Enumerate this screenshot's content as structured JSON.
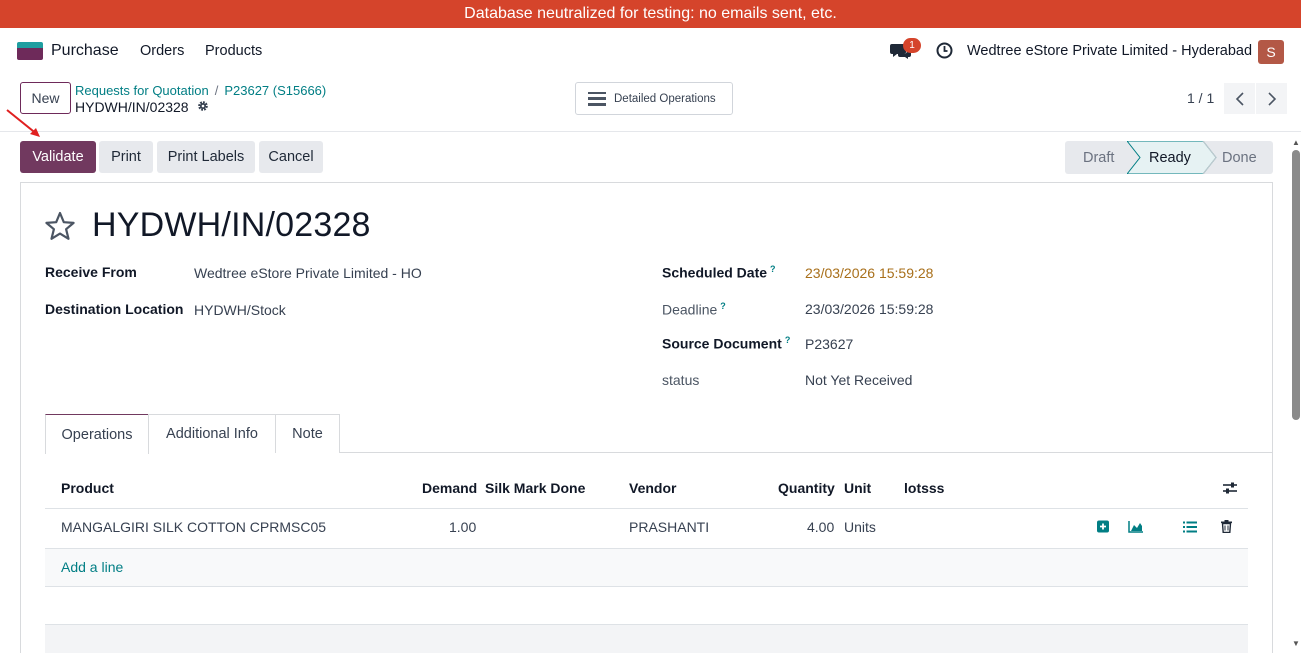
{
  "banner": {
    "text": "Database neutralized for testing: no emails sent, etc."
  },
  "nav": {
    "app_name": "Purchase",
    "menu": [
      "Orders",
      "Products"
    ],
    "chat_badge": "1",
    "company": "Wedtree eStore Private Limited - Hyderabad",
    "avatar_initial": "S"
  },
  "control": {
    "new_label": "New",
    "breadcrumb": [
      "Requests for Quotation",
      "P23627 (S15666)"
    ],
    "breadcrumb_sep": "/",
    "current": "HYDWH/IN/02328",
    "detailed_ops_label": "Detailed Operations",
    "pager": "1 / 1"
  },
  "actions": {
    "validate": "Validate",
    "print": "Print",
    "print_labels": "Print Labels",
    "cancel": "Cancel"
  },
  "status_steps": [
    "Draft",
    "Ready",
    "Done"
  ],
  "status_current": "Ready",
  "record": {
    "title": "HYDWH/IN/02328",
    "receive_from_label": "Receive From",
    "receive_from": "Wedtree eStore Private Limited - HO",
    "destination_label": "Destination Location",
    "destination": "HYDWH/Stock",
    "scheduled_label": "Scheduled Date",
    "scheduled": "23/03/2026 15:59:28",
    "deadline_label": "Deadline",
    "deadline": "23/03/2026 15:59:28",
    "source_label": "Source Document",
    "source": "P23627",
    "status_label": "status",
    "status": "Not Yet Received",
    "help_mark": "?"
  },
  "tabs": [
    "Operations",
    "Additional Info",
    "Note"
  ],
  "table": {
    "headers": {
      "product": "Product",
      "demand": "Demand",
      "silk_mark": "Silk Mark Done",
      "vendor": "Vendor",
      "quantity": "Quantity",
      "unit": "Unit",
      "lots": "lotsss"
    },
    "rows": [
      {
        "product": "MANGALGIRI SILK COTTON CPRMSC05",
        "demand": "1.00",
        "silk_mark": "",
        "vendor": "PRASHANTI",
        "quantity": "4.00",
        "unit": "Units",
        "lots": ""
      }
    ],
    "add_line": "Add a line"
  },
  "colors": {
    "banner": "#d5442b",
    "primary": "#71395f",
    "link": "#017e84",
    "scheduled_date": "#a86f1a"
  },
  "icons": [
    "chat-icon",
    "clock-icon",
    "gear-icon",
    "star-icon",
    "settings-sliders-icon",
    "plus-square-icon",
    "chart-area-icon",
    "list-icon",
    "trash-icon",
    "chevron-left-icon",
    "chevron-right-icon",
    "hamburger-icon"
  ]
}
